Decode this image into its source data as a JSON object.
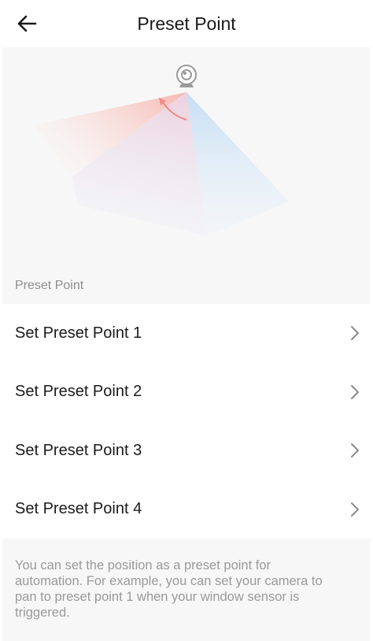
{
  "header": {
    "title": "Preset Point",
    "back_icon": "arrow-left-icon"
  },
  "hero": {
    "icon": "camera-icon",
    "section_label": "Preset Point"
  },
  "presets": [
    {
      "label": "Set Preset Point 1"
    },
    {
      "label": "Set Preset Point 2"
    },
    {
      "label": "Set Preset Point 3"
    },
    {
      "label": "Set Preset Point 4"
    }
  ],
  "note": {
    "text": "You can set the position as a preset point for automation. For example, you can set your camera to pan to preset point 1 when your window sensor is triggered."
  },
  "colors": {
    "accent_red": "#f08a84",
    "accent_blue": "#a9cdef",
    "background_gray": "#f7f7f7"
  }
}
